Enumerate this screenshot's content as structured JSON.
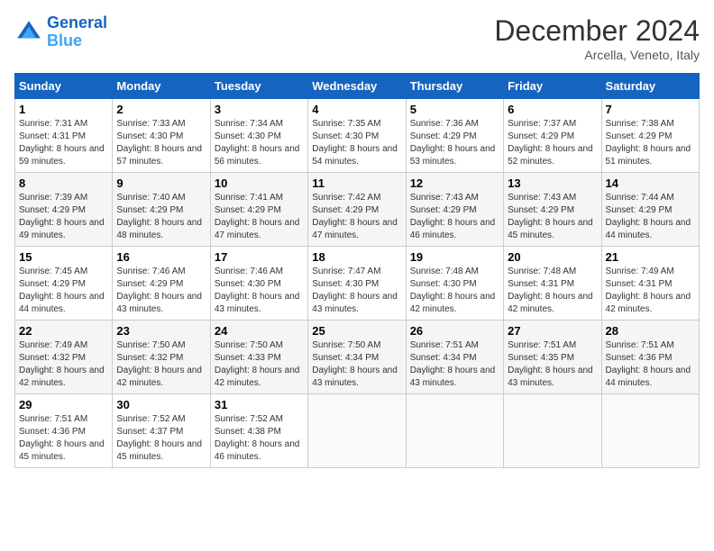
{
  "header": {
    "logo_line1": "General",
    "logo_line2": "Blue",
    "month": "December 2024",
    "location": "Arcella, Veneto, Italy"
  },
  "days_of_week": [
    "Sunday",
    "Monday",
    "Tuesday",
    "Wednesday",
    "Thursday",
    "Friday",
    "Saturday"
  ],
  "weeks": [
    [
      {
        "day": "1",
        "sunrise": "Sunrise: 7:31 AM",
        "sunset": "Sunset: 4:31 PM",
        "daylight": "Daylight: 8 hours and 59 minutes."
      },
      {
        "day": "2",
        "sunrise": "Sunrise: 7:33 AM",
        "sunset": "Sunset: 4:30 PM",
        "daylight": "Daylight: 8 hours and 57 minutes."
      },
      {
        "day": "3",
        "sunrise": "Sunrise: 7:34 AM",
        "sunset": "Sunset: 4:30 PM",
        "daylight": "Daylight: 8 hours and 56 minutes."
      },
      {
        "day": "4",
        "sunrise": "Sunrise: 7:35 AM",
        "sunset": "Sunset: 4:30 PM",
        "daylight": "Daylight: 8 hours and 54 minutes."
      },
      {
        "day": "5",
        "sunrise": "Sunrise: 7:36 AM",
        "sunset": "Sunset: 4:29 PM",
        "daylight": "Daylight: 8 hours and 53 minutes."
      },
      {
        "day": "6",
        "sunrise": "Sunrise: 7:37 AM",
        "sunset": "Sunset: 4:29 PM",
        "daylight": "Daylight: 8 hours and 52 minutes."
      },
      {
        "day": "7",
        "sunrise": "Sunrise: 7:38 AM",
        "sunset": "Sunset: 4:29 PM",
        "daylight": "Daylight: 8 hours and 51 minutes."
      }
    ],
    [
      {
        "day": "8",
        "sunrise": "Sunrise: 7:39 AM",
        "sunset": "Sunset: 4:29 PM",
        "daylight": "Daylight: 8 hours and 49 minutes."
      },
      {
        "day": "9",
        "sunrise": "Sunrise: 7:40 AM",
        "sunset": "Sunset: 4:29 PM",
        "daylight": "Daylight: 8 hours and 48 minutes."
      },
      {
        "day": "10",
        "sunrise": "Sunrise: 7:41 AM",
        "sunset": "Sunset: 4:29 PM",
        "daylight": "Daylight: 8 hours and 47 minutes."
      },
      {
        "day": "11",
        "sunrise": "Sunrise: 7:42 AM",
        "sunset": "Sunset: 4:29 PM",
        "daylight": "Daylight: 8 hours and 47 minutes."
      },
      {
        "day": "12",
        "sunrise": "Sunrise: 7:43 AM",
        "sunset": "Sunset: 4:29 PM",
        "daylight": "Daylight: 8 hours and 46 minutes."
      },
      {
        "day": "13",
        "sunrise": "Sunrise: 7:43 AM",
        "sunset": "Sunset: 4:29 PM",
        "daylight": "Daylight: 8 hours and 45 minutes."
      },
      {
        "day": "14",
        "sunrise": "Sunrise: 7:44 AM",
        "sunset": "Sunset: 4:29 PM",
        "daylight": "Daylight: 8 hours and 44 minutes."
      }
    ],
    [
      {
        "day": "15",
        "sunrise": "Sunrise: 7:45 AM",
        "sunset": "Sunset: 4:29 PM",
        "daylight": "Daylight: 8 hours and 44 minutes."
      },
      {
        "day": "16",
        "sunrise": "Sunrise: 7:46 AM",
        "sunset": "Sunset: 4:29 PM",
        "daylight": "Daylight: 8 hours and 43 minutes."
      },
      {
        "day": "17",
        "sunrise": "Sunrise: 7:46 AM",
        "sunset": "Sunset: 4:30 PM",
        "daylight": "Daylight: 8 hours and 43 minutes."
      },
      {
        "day": "18",
        "sunrise": "Sunrise: 7:47 AM",
        "sunset": "Sunset: 4:30 PM",
        "daylight": "Daylight: 8 hours and 43 minutes."
      },
      {
        "day": "19",
        "sunrise": "Sunrise: 7:48 AM",
        "sunset": "Sunset: 4:30 PM",
        "daylight": "Daylight: 8 hours and 42 minutes."
      },
      {
        "day": "20",
        "sunrise": "Sunrise: 7:48 AM",
        "sunset": "Sunset: 4:31 PM",
        "daylight": "Daylight: 8 hours and 42 minutes."
      },
      {
        "day": "21",
        "sunrise": "Sunrise: 7:49 AM",
        "sunset": "Sunset: 4:31 PM",
        "daylight": "Daylight: 8 hours and 42 minutes."
      }
    ],
    [
      {
        "day": "22",
        "sunrise": "Sunrise: 7:49 AM",
        "sunset": "Sunset: 4:32 PM",
        "daylight": "Daylight: 8 hours and 42 minutes."
      },
      {
        "day": "23",
        "sunrise": "Sunrise: 7:50 AM",
        "sunset": "Sunset: 4:32 PM",
        "daylight": "Daylight: 8 hours and 42 minutes."
      },
      {
        "day": "24",
        "sunrise": "Sunrise: 7:50 AM",
        "sunset": "Sunset: 4:33 PM",
        "daylight": "Daylight: 8 hours and 42 minutes."
      },
      {
        "day": "25",
        "sunrise": "Sunrise: 7:50 AM",
        "sunset": "Sunset: 4:34 PM",
        "daylight": "Daylight: 8 hours and 43 minutes."
      },
      {
        "day": "26",
        "sunrise": "Sunrise: 7:51 AM",
        "sunset": "Sunset: 4:34 PM",
        "daylight": "Daylight: 8 hours and 43 minutes."
      },
      {
        "day": "27",
        "sunrise": "Sunrise: 7:51 AM",
        "sunset": "Sunset: 4:35 PM",
        "daylight": "Daylight: 8 hours and 43 minutes."
      },
      {
        "day": "28",
        "sunrise": "Sunrise: 7:51 AM",
        "sunset": "Sunset: 4:36 PM",
        "daylight": "Daylight: 8 hours and 44 minutes."
      }
    ],
    [
      {
        "day": "29",
        "sunrise": "Sunrise: 7:51 AM",
        "sunset": "Sunset: 4:36 PM",
        "daylight": "Daylight: 8 hours and 45 minutes."
      },
      {
        "day": "30",
        "sunrise": "Sunrise: 7:52 AM",
        "sunset": "Sunset: 4:37 PM",
        "daylight": "Daylight: 8 hours and 45 minutes."
      },
      {
        "day": "31",
        "sunrise": "Sunrise: 7:52 AM",
        "sunset": "Sunset: 4:38 PM",
        "daylight": "Daylight: 8 hours and 46 minutes."
      },
      null,
      null,
      null,
      null
    ]
  ]
}
